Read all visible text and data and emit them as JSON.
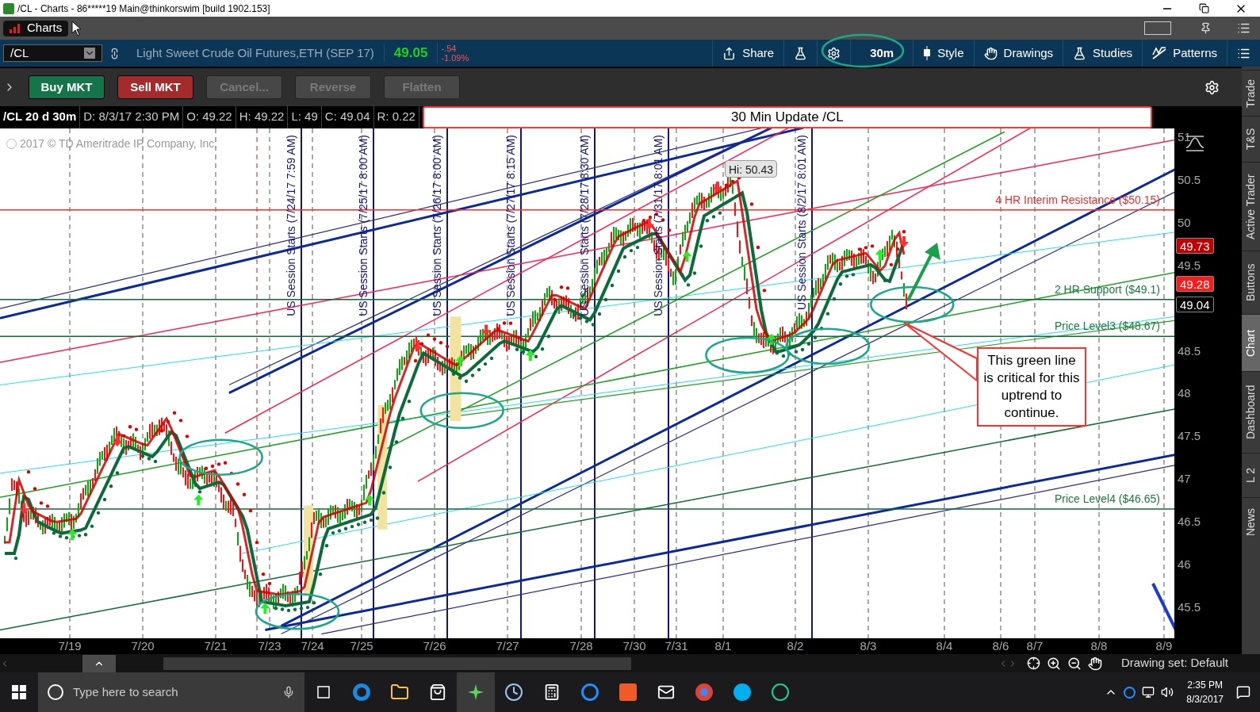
{
  "window": {
    "title": "/CL - Charts - 86*****19 Main@thinkorswim [build 1902.153]"
  },
  "tab": {
    "label": "Charts"
  },
  "symbol_bar": {
    "symbol": "/CL",
    "description": "Light Sweet Crude Oil Futures,ETH (SEP 17)",
    "last": "49.05",
    "change": "-.54",
    "change_pct": "-1.09%",
    "buttons": [
      {
        "label": "Share"
      },
      {
        "label": "30m"
      },
      {
        "label": "Style"
      },
      {
        "label": "Drawings"
      },
      {
        "label": "Studies"
      },
      {
        "label": "Patterns"
      }
    ]
  },
  "order_bar": {
    "buttons": [
      {
        "label": "Buy MKT",
        "kind": "buy",
        "disabled": false
      },
      {
        "label": "Sell MKT",
        "kind": "sell",
        "disabled": false
      },
      {
        "label": "Cancel...",
        "kind": "plain",
        "disabled": true
      },
      {
        "label": "Reverse",
        "kind": "plain",
        "disabled": true
      },
      {
        "label": "Flatten",
        "kind": "plain",
        "disabled": true
      }
    ]
  },
  "chart": {
    "header": [
      "/CL 20 d 30m",
      "D: 8/3/17 2:30 PM",
      "O: 49.22",
      "H: 49.22",
      "L: 49",
      "C: 49.04",
      "R: 0.22"
    ],
    "title": "30 Min Update /CL",
    "copyright": "2017 © TD Ameritrade IP Company, Inc.",
    "high_label": "Hi: 50.43",
    "levels": [
      {
        "label": "4 HR Interim Resistance ($50.15)",
        "color": "#ff2a2a"
      },
      {
        "label": "2 HR Support ($49.1)",
        "color": "#1a7a3c"
      },
      {
        "label": "Price Level3 ($48.67)",
        "color": "#1a7a3c"
      },
      {
        "label": "Price Level4 ($46.65)",
        "color": "#1a7a3c"
      }
    ],
    "session_labels": [
      "US Session Starts (7/24/17 7:59 AM)",
      "US Session Starts (7/25/17 8:00 AM)",
      "US Session Starts (7/26/17 8:00 AM)",
      "US Session Starts (7/27/17 8:15 AM)",
      "US Session Starts (7/28/17 8:30 AM)",
      "US Session Starts (7/31/17 8:01 AM)",
      "US Session Starts (8/2/17 8:01 AM)"
    ],
    "callout": "This green line is critical for this uptrend to continue.",
    "price_ticks": [
      "51",
      "50.5",
      "50",
      "49.5",
      "48.5",
      "48",
      "47.5",
      "47",
      "46.5",
      "46",
      "45.5"
    ],
    "price_badges": [
      {
        "value": "49.73",
        "color": "#c00000"
      },
      {
        "value": "49.28",
        "color": "#ff1a1a"
      },
      {
        "value": "49.04",
        "color": "#000000"
      }
    ],
    "dates": [
      "7/19",
      "7/20",
      "7/21",
      "7/23",
      "7/24",
      "7/25",
      "7/26",
      "7/27",
      "7/28",
      "7/30",
      "7/31",
      "8/1",
      "8/2",
      "8/3",
      "8/4",
      "8/6",
      "8/7",
      "8/8",
      "8/9"
    ]
  },
  "side_tabs": [
    {
      "label": "Trade",
      "selected": false
    },
    {
      "label": "T&S",
      "selected": false
    },
    {
      "label": "Active Trader",
      "selected": false
    },
    {
      "label": "Buttons",
      "selected": false
    },
    {
      "label": "Chart",
      "selected": true
    },
    {
      "label": "Dashboard",
      "selected": false
    },
    {
      "label": "L 2",
      "selected": false
    },
    {
      "label": "News",
      "selected": false
    }
  ],
  "bottom_bar": {
    "drawing_set": "Drawing set: Default"
  },
  "taskbar": {
    "search_placeholder": "Type here to search",
    "time": "2:35 PM",
    "date": "8/3/2017"
  }
}
